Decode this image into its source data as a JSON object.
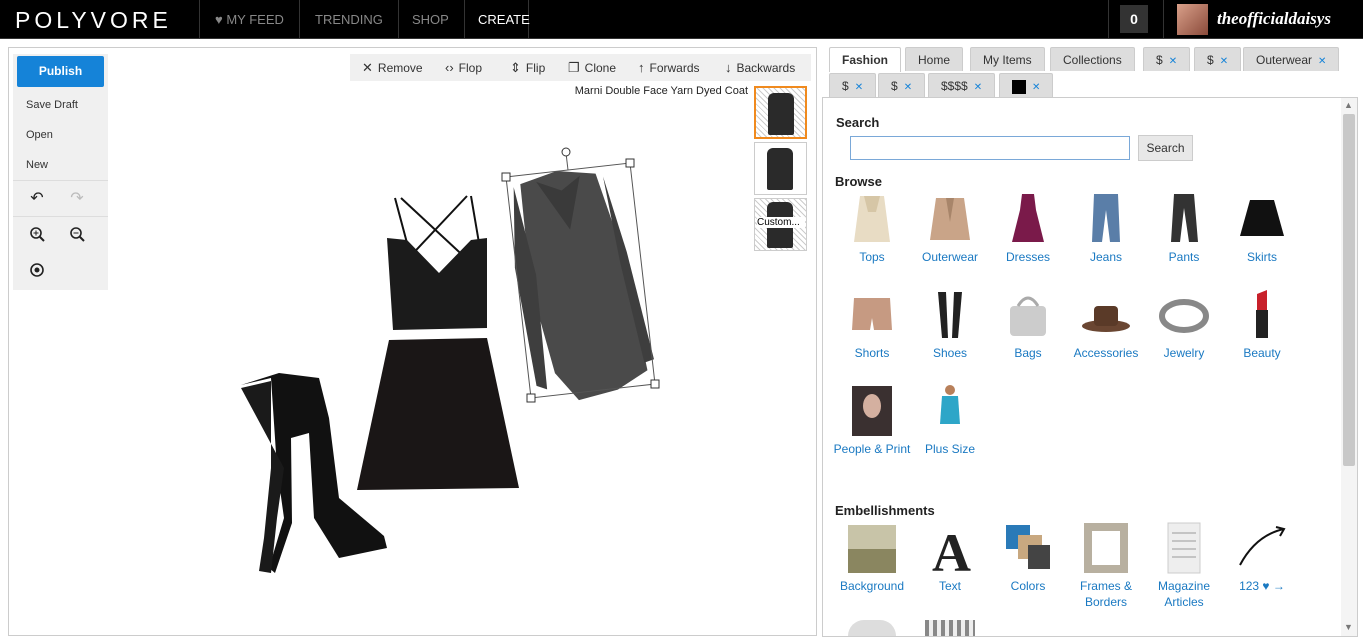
{
  "header": {
    "logo": "POLYVORE",
    "nav": [
      {
        "label": "MY FEED",
        "icon": "heart-icon"
      },
      {
        "label": "TRENDING"
      },
      {
        "label": "SHOP"
      },
      {
        "label": "CREATE"
      }
    ],
    "cart_count": "0",
    "username": "theofficialdaisys"
  },
  "editor": {
    "left_menu": {
      "publish": "Publish",
      "save_draft": "Save Draft",
      "open": "Open",
      "new": "New"
    },
    "toolbar": {
      "remove": "Remove",
      "flop": "Flop",
      "flip": "Flip",
      "clone": "Clone",
      "forwards": "Forwards",
      "backwards": "Backwards"
    },
    "selected_item_name": "Marni Double Face Yarn Dyed Coat",
    "thumb_custom_label": "Custom..."
  },
  "browser": {
    "tabs": [
      {
        "label": "Fashion"
      },
      {
        "label": "Home"
      },
      {
        "label": "My Items"
      },
      {
        "label": "Collections"
      },
      {
        "label": "$"
      },
      {
        "label": "$"
      },
      {
        "label": "Outerwear"
      },
      {
        "label": "$"
      },
      {
        "label": "$"
      },
      {
        "label": "$$$$"
      }
    ],
    "search_heading": "Search",
    "search_button": "Search",
    "search_value": "",
    "browse_heading": "Browse",
    "categories": [
      {
        "label": "Tops"
      },
      {
        "label": "Outerwear"
      },
      {
        "label": "Dresses"
      },
      {
        "label": "Jeans"
      },
      {
        "label": "Pants"
      },
      {
        "label": "Skirts"
      },
      {
        "label": "Shorts"
      },
      {
        "label": "Shoes"
      },
      {
        "label": "Bags"
      },
      {
        "label": "Accessories"
      },
      {
        "label": "Jewelry"
      },
      {
        "label": "Beauty"
      },
      {
        "label": "People & Print"
      },
      {
        "label": "Plus Size"
      }
    ],
    "embellishments_heading": "Embellishments",
    "embellishments": [
      {
        "label": "Background"
      },
      {
        "label": "Text"
      },
      {
        "label": "Colors"
      },
      {
        "label": "Frames & Borders"
      },
      {
        "label": "Magazine Articles"
      },
      {
        "label": "123 ♥ →"
      }
    ],
    "colors": {
      "accent": "#1583d8",
      "link": "#1a79c2",
      "selection": "#f08a1e"
    }
  }
}
